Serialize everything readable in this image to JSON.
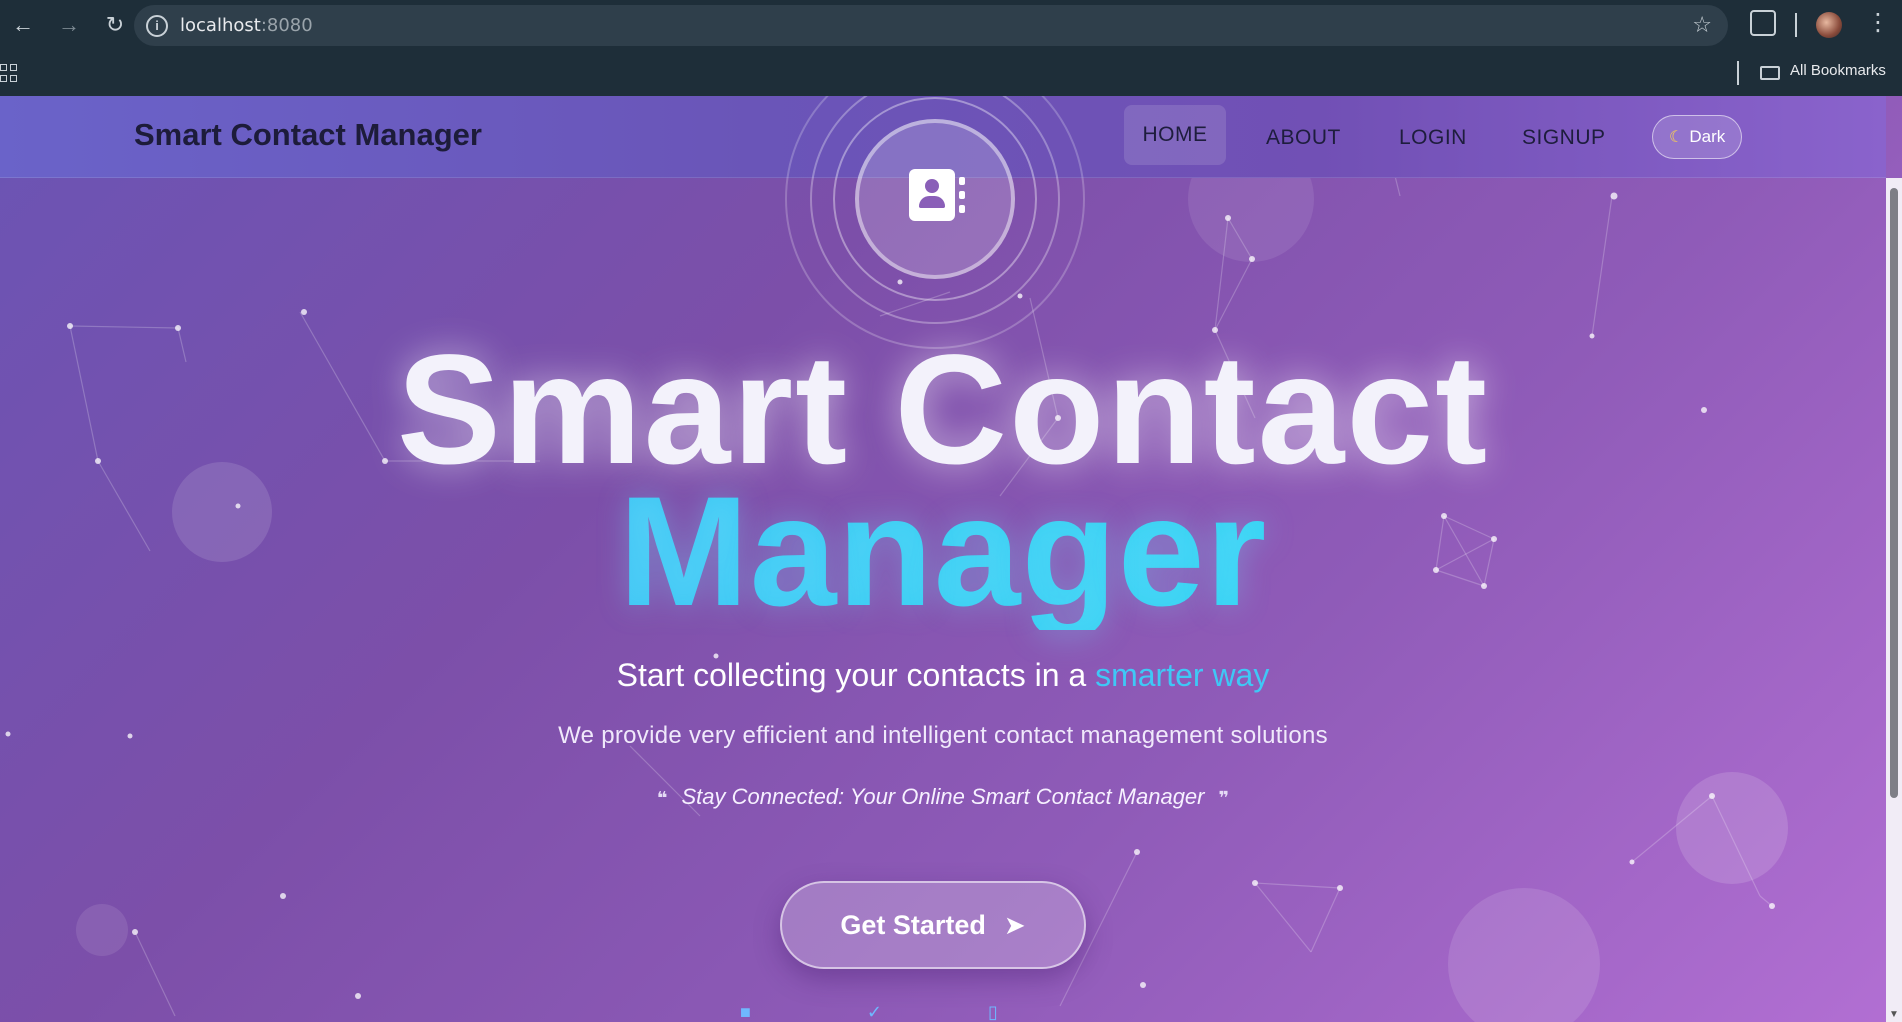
{
  "browser": {
    "url_host": "localhost",
    "url_port": ":8080",
    "bookmarks_label": "All Bookmarks"
  },
  "header": {
    "brand": "Smart Contact Manager",
    "nav": [
      "HOME",
      "ABOUT",
      "LOGIN",
      "SIGNUP"
    ],
    "theme_toggle": "Dark"
  },
  "hero": {
    "title_line1": "Smart Contact",
    "title_line2": "Manager",
    "tagline_prefix": "Start collecting your contacts in a",
    "tagline_accent": "smarter way",
    "subtext": "We provide very efficient and intelligent contact management solutions",
    "quote": "Stay Connected: Your Online Smart Contact Manager",
    "cta_label": "Get Started"
  },
  "colors": {
    "accent_cyan": "#3fc8f6",
    "header_bg": "#6a55b8",
    "hero_bg_start": "#6b54b4",
    "hero_bg_end": "#b26fd3"
  }
}
